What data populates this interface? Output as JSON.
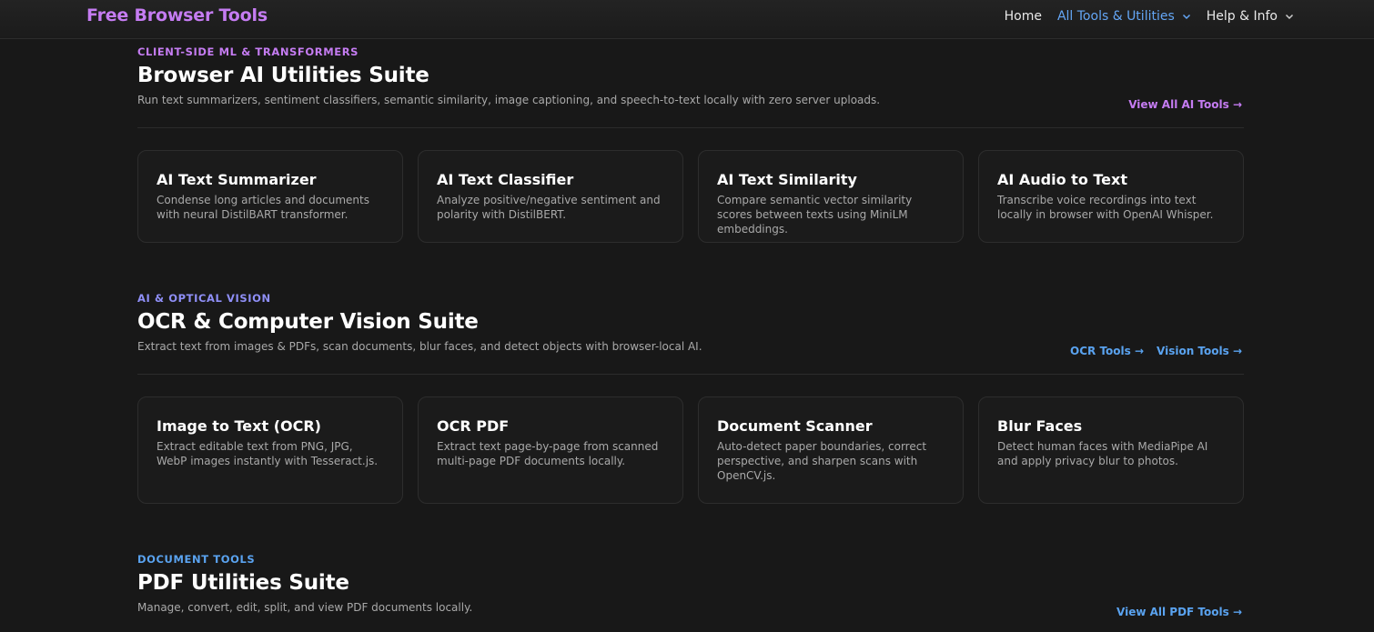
{
  "header": {
    "brand": "Free Browser Tools",
    "nav": [
      {
        "label": "Home",
        "active": false,
        "dropdown": false
      },
      {
        "label": "All Tools & Utilities",
        "active": true,
        "dropdown": true
      },
      {
        "label": "Help & Info",
        "active": false,
        "dropdown": true
      }
    ]
  },
  "sections": [
    {
      "eyebrow": "CLIENT-SIDE ML & TRANSFORMERS",
      "title": "Browser AI Utilities Suite",
      "description": "Run text summarizers, sentiment classifiers, semantic similarity, image captioning, and speech-to-text locally with zero server uploads.",
      "links": [
        "View All AI Tools →"
      ],
      "cards": [
        {
          "title": "AI Text Summarizer",
          "description": "Condense long articles and documents with neural DistilBART transformer."
        },
        {
          "title": "AI Text Classifier",
          "description": "Analyze positive/negative sentiment and polarity with DistilBERT."
        },
        {
          "title": "AI Text Similarity",
          "description": "Compare semantic vector similarity scores between texts using MiniLM embeddings."
        },
        {
          "title": "AI Audio to Text",
          "description": "Transcribe voice recordings into text locally in browser with OpenAI Whisper."
        }
      ]
    },
    {
      "eyebrow": "AI & OPTICAL VISION",
      "title": "OCR & Computer Vision Suite",
      "description": "Extract text from images & PDFs, scan documents, blur faces, and detect objects with browser-local AI.",
      "links": [
        "OCR Tools →",
        "Vision Tools →"
      ],
      "cards": [
        {
          "title": "Image to Text (OCR)",
          "description": "Extract editable text from PNG, JPG, WebP images instantly with Tesseract.js."
        },
        {
          "title": "OCR PDF",
          "description": "Extract text page-by-page from scanned multi-page PDF documents locally."
        },
        {
          "title": "Document Scanner",
          "description": "Auto-detect paper boundaries, correct perspective, and sharpen scans with OpenCV.js."
        },
        {
          "title": "Blur Faces",
          "description": "Detect human faces with MediaPipe AI and apply privacy blur to photos."
        }
      ]
    },
    {
      "eyebrow": "DOCUMENT TOOLS",
      "title": "PDF Utilities Suite",
      "description": "Manage, convert, edit, split, and view PDF documents locally.",
      "links": [
        "View All PDF Tools →"
      ]
    }
  ],
  "colors": {
    "background": "#181818",
    "brand": "#c57cf2",
    "accent_blue": "#5aa3f0",
    "accent_indigo": "#8f8ff7"
  }
}
